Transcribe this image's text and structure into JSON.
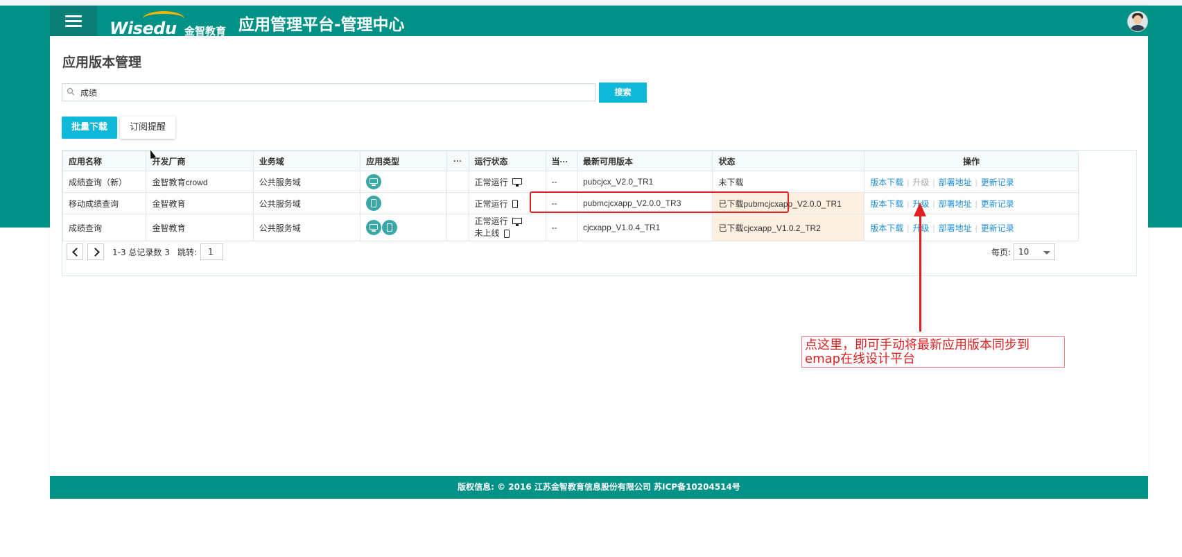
{
  "app": {
    "logo_text": "Wisedu",
    "logo_cn": "金智教育",
    "title": "应用管理平台-管理中心"
  },
  "page": {
    "title": "应用版本管理",
    "search": {
      "value": "成绩",
      "placeholder": ""
    },
    "search_button": "搜索",
    "batch_download_button": "批量下载",
    "subscribe_button": "订阅提醒"
  },
  "table": {
    "columns": [
      "应用名称",
      "开发厂商",
      "业务域",
      "应用类型",
      "···",
      "运行状态",
      "当···",
      "最新可用版本",
      "状态",
      "操作"
    ],
    "rows": [
      {
        "name": "成绩查询（新）",
        "vendor": "金智教育crowd",
        "domain": "公共服务域",
        "types": [
          "pc"
        ],
        "run_status": "正常运行",
        "run_status_icon": "monitor",
        "current": "--",
        "latest_version": "pubcjcx_V2.0_TR1",
        "status": "未下载",
        "actions": [
          "版本下载",
          "升级",
          "部署地址",
          "更新记录"
        ]
      },
      {
        "name": "移动成绩查询",
        "vendor": "金智教育",
        "domain": "公共服务域",
        "types": [
          "mobile"
        ],
        "run_status": "正常运行",
        "run_status_icon": "phone",
        "current": "--",
        "latest_version": "pubmcjcxapp_V2.0.0_TR3",
        "status": "已下载pubmcjcxapp_V2.0.0_TR1",
        "actions": [
          "版本下载",
          "升级",
          "部署地址",
          "更新记录"
        ]
      },
      {
        "name": "成绩查询",
        "vendor": "金智教育",
        "domain": "公共服务域",
        "types": [
          "pc",
          "mobile"
        ],
        "run_status": "正常运行",
        "run_status_icon": "monitor",
        "run_status_2": "未上线",
        "run_status_2_icon": "phone",
        "current": "--",
        "latest_version": "cjcxapp_V1.0.4_TR1",
        "status": "已下载cjcxapp_V1.0.2_TR2",
        "actions": [
          "版本下载",
          "升级",
          "部署地址",
          "更新记录"
        ]
      }
    ]
  },
  "pager": {
    "prev_icon": "chevron-left-icon",
    "next_icon": "chevron-right-icon",
    "info": "1-3 总记录数 3",
    "jump_label": "跳转:",
    "jump_value": "1",
    "per_page_label": "每页:",
    "per_page_value": "10"
  },
  "footer": {
    "text": "版权信息: © 2016 江苏金智教育信息股份有限公司 苏ICP备10204514号"
  },
  "annotation": {
    "note": "点这里，即可手动将最新应用版本同步到emap在线设计平台",
    "color": "#e02020"
  },
  "colors": {
    "brand": "#009286",
    "accent": "#0fb7d8",
    "link": "#1e8fd6",
    "highlight": "#fdf0e0"
  }
}
